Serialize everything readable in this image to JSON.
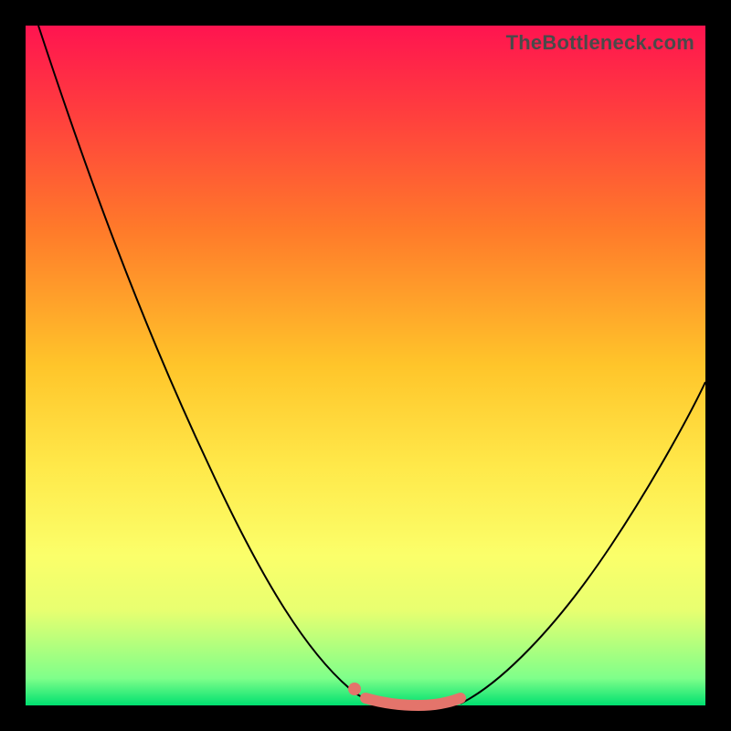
{
  "watermark": "TheBottleneck.com",
  "colors": {
    "accent_pink": "#e4746b",
    "curve_stroke": "#000000",
    "gradient_top": "#ff1450",
    "gradient_bottom": "#00e070"
  },
  "chart_data": {
    "type": "line",
    "title": "",
    "xlabel": "",
    "ylabel": "",
    "xlim": [
      0,
      100
    ],
    "ylim": [
      0,
      100
    ],
    "series": [
      {
        "name": "left-curve",
        "x": [
          2,
          10,
          20,
          30,
          38,
          44,
          48,
          50
        ],
        "y": [
          100,
          78,
          53,
          31,
          15,
          6,
          1,
          0
        ]
      },
      {
        "name": "right-curve",
        "x": [
          64,
          70,
          78,
          86,
          94,
          100
        ],
        "y": [
          0,
          7,
          18,
          31,
          45,
          56
        ]
      },
      {
        "name": "optimal-band",
        "x": [
          50,
          53,
          57,
          61,
          64
        ],
        "y": [
          0.5,
          0,
          0,
          0,
          0.5
        ]
      }
    ],
    "marker": {
      "x": 49,
      "y": 2
    }
  }
}
